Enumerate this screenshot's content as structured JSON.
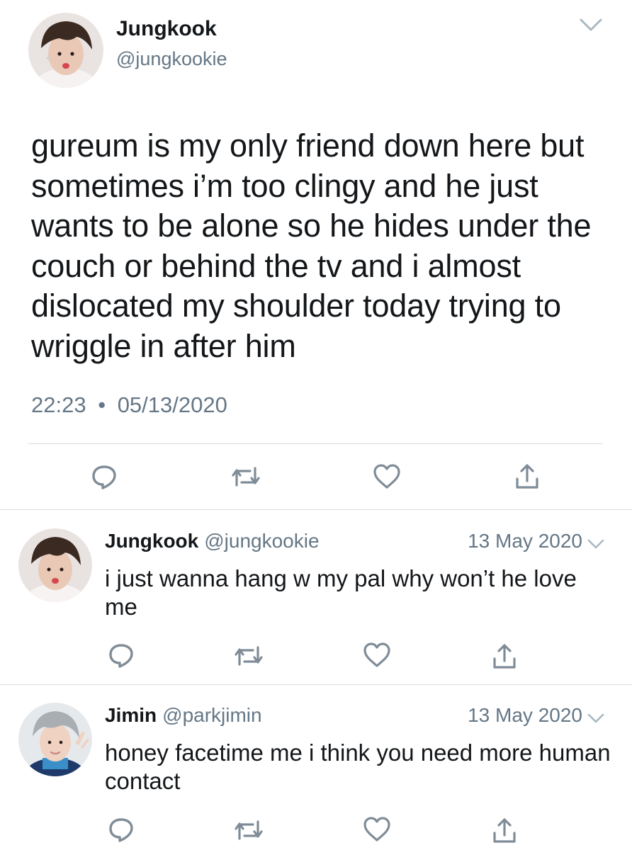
{
  "main_tweet": {
    "name": "Jungkook",
    "handle": "@jungkookie",
    "text": "gureum is my only friend down here but sometimes i’m too clingy and he just wants to be alone so he hides under the couch or behind the tv and i almost dislocated my shoulder today trying to wriggle in after him",
    "time": "22:23",
    "separator": "•",
    "date": "05/13/2020",
    "icons": [
      "reply-icon",
      "retweet-icon",
      "like-icon",
      "share-icon"
    ]
  },
  "replies": [
    {
      "name": "Jungkook",
      "handle": "@jungkookie",
      "date": "13 May 2020",
      "text": "i just wanna hang w my pal why won’t he love me"
    },
    {
      "name": "Jimin",
      "handle": "@parkjimin",
      "date": "13 May 2020",
      "text": "honey facetime me i think you need more human contact"
    }
  ],
  "colors": {
    "text": "#14171a",
    "secondary": "#657786",
    "icon": "#7f8c97",
    "divider": "#d8dde1"
  }
}
